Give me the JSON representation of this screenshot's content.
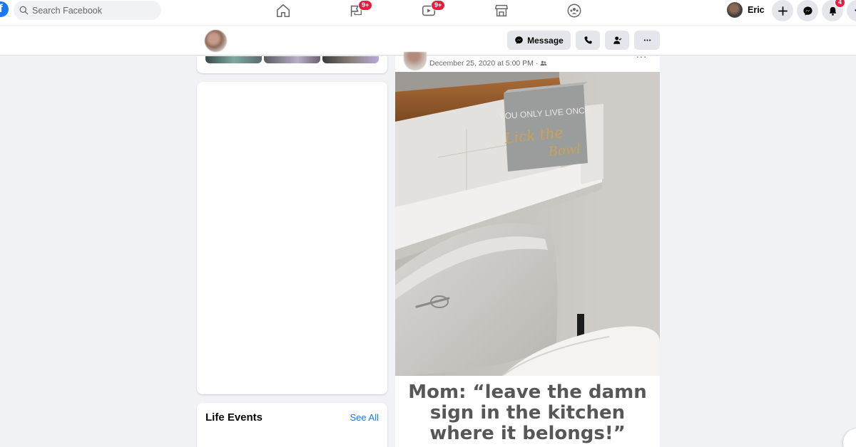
{
  "topbar": {
    "search_placeholder": "Search Facebook",
    "nav": [
      {
        "name": "home",
        "icon": "home-icon"
      },
      {
        "name": "pages",
        "icon": "flag-icon",
        "badge": "9+"
      },
      {
        "name": "watch",
        "icon": "video-icon",
        "badge": "9+"
      },
      {
        "name": "marketplace",
        "icon": "store-icon"
      },
      {
        "name": "groups",
        "icon": "groups-icon"
      }
    ],
    "user_name": "Eric",
    "notifications_badge": "4"
  },
  "profile_bar": {
    "message_label": "Message"
  },
  "left": {
    "life_events_title": "Life Events",
    "see_all": "See All"
  },
  "post": {
    "date": "December 25, 2020 at 5:00 PM ·",
    "privacy_icon": "friends-icon",
    "sign_text": [
      "YOU ONLY LIVE ONCE",
      "Lick the",
      "Bowl"
    ],
    "caption_lines": [
      "Mom: “leave the damn",
      "sign in the kitchen",
      "where it belongs!”"
    ]
  },
  "colors": {
    "brand": "#1877f2",
    "badge": "#e41e3f",
    "background": "#f0f2f5"
  }
}
